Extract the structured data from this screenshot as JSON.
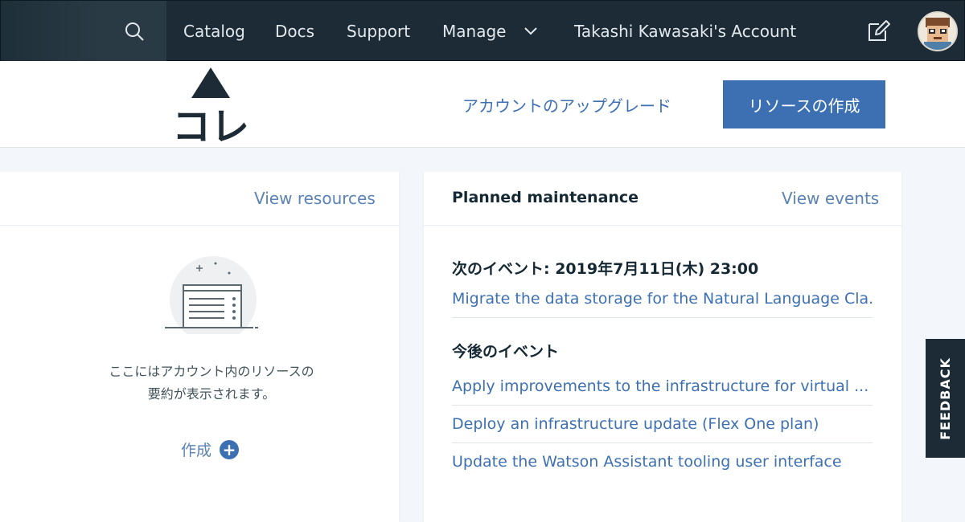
{
  "topnav": {
    "items": [
      "Catalog",
      "Docs",
      "Support",
      "Manage"
    ],
    "account": "Takashi Kawasaki's Account",
    "icons": {
      "search": "search-icon",
      "manage_dropdown": "chevron-down-icon",
      "edit": "edit-icon",
      "avatar": "avatar"
    }
  },
  "annotation": {
    "text": "コレ",
    "arrow": "arrow-up-icon"
  },
  "header": {
    "upgrade_link": "アカウントのアップグレード",
    "create_button": "リソースの作成"
  },
  "resources_card": {
    "view_link": "View resources",
    "empty_text_line1": "ここにはアカウント内のリソースの",
    "empty_text_line2": "要約が表示されます。",
    "create_link": "作成",
    "create_icon": "plus-circle-icon"
  },
  "maintenance_card": {
    "title": "Planned maintenance",
    "view_link": "View events",
    "next_label": "次のイベント: 2019年7月11日(木) 23:00",
    "next_event": "Migrate the data storage for the Natural Language Cla...",
    "upcoming_label": "今後のイベント",
    "upcoming_events": [
      "Apply improvements to the infrastructure for virtual ...",
      "Deploy an infrastructure update (Flex One plan)",
      "Update the Watson Assistant tooling user interface"
    ]
  },
  "feedback_tab": "FEEDBACK",
  "colors": {
    "nav_bg": "#1d2b36",
    "primary": "#3d70b2",
    "link": "#5a82b5",
    "page_bg": "#f3f6fa"
  }
}
